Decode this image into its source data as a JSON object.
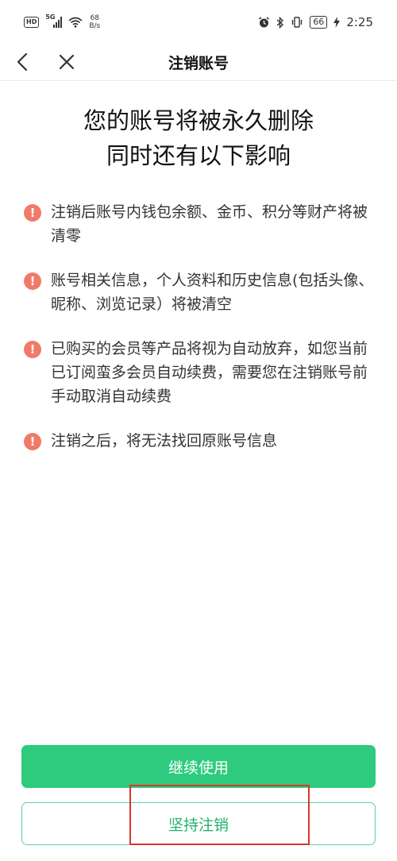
{
  "status_bar": {
    "hd": "HD",
    "network_type": "5G",
    "net_speed_value": "68",
    "net_speed_unit": "B/s",
    "battery": "66",
    "time": "2:25"
  },
  "nav": {
    "title": "注销账号"
  },
  "headline": {
    "line1": "您的账号将被永久删除",
    "line2": "同时还有以下影响"
  },
  "impacts": [
    {
      "icon": "!",
      "text": "注销后账号内钱包余额、金币、积分等财产将被清零"
    },
    {
      "icon": "!",
      "text": "账号相关信息，个人资料和历史信息(包括头像、昵称、浏览记录）将被清空"
    },
    {
      "icon": "!",
      "text": "已购买的会员等产品将视为自动放弃，如您当前已订阅蛮多会员自动续费，需要您在注销账号前手动取消自动续费"
    },
    {
      "icon": "!",
      "text": "注销之后，将无法找回原账号信息"
    }
  ],
  "buttons": {
    "continue_label": "继续使用",
    "cancel_account_label": "坚持注销"
  },
  "colors": {
    "primary_green": "#2ecb7f",
    "warning": "#f07a6a",
    "highlight": "#d9362b"
  }
}
